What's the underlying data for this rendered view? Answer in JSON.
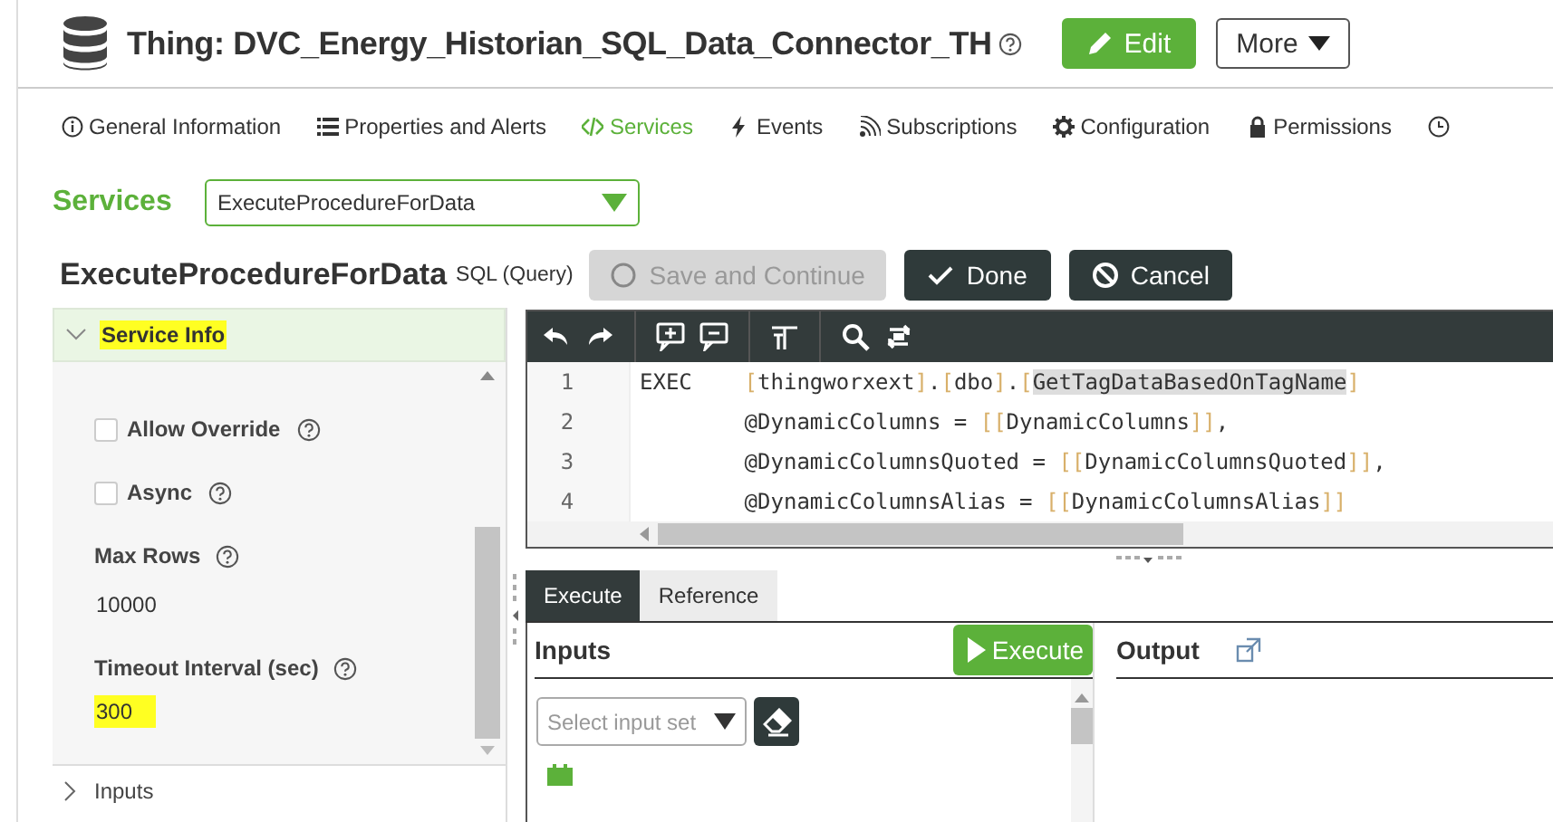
{
  "header": {
    "title": "Thing: DVC_Energy_Historian_SQL_Data_Connector_TH",
    "buttons": [
      {
        "label": "Edit",
        "kind": "primary"
      },
      {
        "label": "More",
        "kind": "menu"
      }
    ]
  },
  "tabs": [
    {
      "label": "General Information",
      "selected": false
    },
    {
      "label": "Properties and Alerts",
      "selected": false
    },
    {
      "label": "Services",
      "selected": true
    },
    {
      "label": "Events",
      "selected": false
    },
    {
      "label": "Subscriptions",
      "selected": false
    },
    {
      "label": "Configuration",
      "selected": false
    },
    {
      "label": "Permissions",
      "selected": false
    }
  ],
  "services": {
    "label": "Services",
    "value": "ExecuteProcedureForData"
  },
  "service": {
    "name": "ExecuteProcedureForData",
    "type": "SQL (Query)",
    "buttons": [
      {
        "label": "Save and Continue",
        "kind": "save",
        "disabled": true
      },
      {
        "label": "Done",
        "kind": "done",
        "disabled": false
      },
      {
        "label": "Cancel",
        "kind": "cancel",
        "disabled": false
      }
    ]
  },
  "service_info": {
    "title": "Service Info",
    "expanded": true,
    "highlighted": true,
    "fields": [
      {
        "kind": "checkbox",
        "label": "Allow Override",
        "checked": false
      },
      {
        "kind": "checkbox",
        "label": "Async",
        "checked": false
      },
      {
        "kind": "value",
        "label": "Max Rows",
        "value": "10000",
        "highlighted": false
      },
      {
        "kind": "value",
        "label": "Timeout Interval (sec)",
        "value": "300",
        "highlighted": true
      }
    ]
  },
  "inputs_section": {
    "label": "Inputs",
    "expanded": false
  },
  "editor": {
    "lines": [
      {
        "number": "1",
        "segments": [
          {
            "kind": "plain",
            "text": "EXEC    "
          },
          {
            "kind": "bracket",
            "text": "["
          },
          {
            "kind": "plain",
            "text": "thingworxext"
          },
          {
            "kind": "bracket",
            "text": "]"
          },
          {
            "kind": "plain",
            "text": "."
          },
          {
            "kind": "bracket",
            "text": "["
          },
          {
            "kind": "plain",
            "text": "dbo"
          },
          {
            "kind": "bracket",
            "text": "]"
          },
          {
            "kind": "plain",
            "text": "."
          },
          {
            "kind": "bracket",
            "text": "["
          },
          {
            "kind": "selected",
            "text": "GetTagDataBasedOnTagName"
          },
          {
            "kind": "bracket",
            "text": "]"
          }
        ]
      },
      {
        "number": "2",
        "segments": [
          {
            "kind": "plain",
            "text": "        @DynamicColumns = "
          },
          {
            "kind": "bracket",
            "text": "[["
          },
          {
            "kind": "plain",
            "text": "DynamicColumns"
          },
          {
            "kind": "bracket",
            "text": "]]"
          },
          {
            "kind": "plain",
            "text": ","
          }
        ]
      },
      {
        "number": "3",
        "segments": [
          {
            "kind": "plain",
            "text": "        @DynamicColumnsQuoted = "
          },
          {
            "kind": "bracket",
            "text": "[["
          },
          {
            "kind": "plain",
            "text": "DynamicColumnsQuoted"
          },
          {
            "kind": "bracket",
            "text": "]]"
          },
          {
            "kind": "plain",
            "text": ","
          }
        ]
      },
      {
        "number": "4",
        "segments": [
          {
            "kind": "plain",
            "text": "        @DynamicColumnsAlias = "
          },
          {
            "kind": "bracket",
            "text": "[["
          },
          {
            "kind": "plain",
            "text": "DynamicColumnsAlias"
          },
          {
            "kind": "bracket",
            "text": "]]"
          }
        ]
      }
    ]
  },
  "bottom_tabs": [
    {
      "label": "Execute",
      "selected": true
    },
    {
      "label": "Reference",
      "selected": false
    }
  ],
  "inputs": {
    "title": "Inputs",
    "execute_button": "Execute",
    "input_set": {
      "placeholder": "Select input set"
    }
  },
  "output": {
    "title": "Output"
  }
}
